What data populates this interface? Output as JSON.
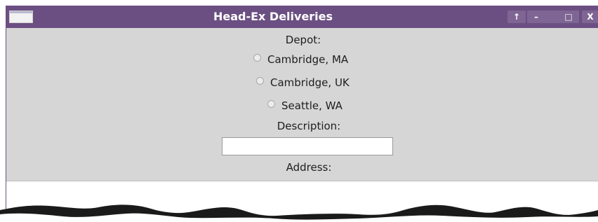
{
  "window": {
    "title": "Head-Ex Deliveries",
    "buttons": {
      "up": "↑",
      "minimize": "–",
      "maximize": "□",
      "close": "X"
    }
  },
  "form": {
    "depot_label": "Depot:",
    "depots": [
      {
        "label": "Cambridge, MA",
        "selected": false
      },
      {
        "label": "Cambridge, UK",
        "selected": false
      },
      {
        "label": "Seattle, WA",
        "selected": false
      }
    ],
    "description_label": "Description:",
    "description_value": "",
    "address_label": "Address:",
    "address_value": ""
  },
  "colors": {
    "titlebar": "#6b4f82",
    "window_bg": "#d6d6d6",
    "field_bg": "#ffffff"
  }
}
